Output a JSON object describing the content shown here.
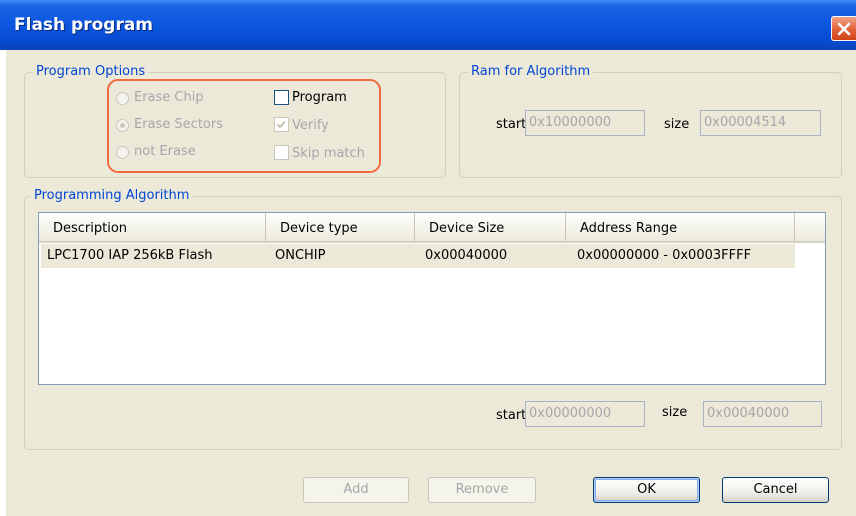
{
  "window": {
    "title": "Flash program"
  },
  "program_options": {
    "legend": "Program Options",
    "erase_chip": "Erase Chip",
    "erase_sectors": "Erase Sectors",
    "not_erase": "not Erase",
    "program": "Program",
    "verify": "Verify",
    "skip_match": "Skip match",
    "selected": "Erase Sectors",
    "program_checked": false,
    "verify_checked": true,
    "skip_match_checked": false
  },
  "ram": {
    "legend": "Ram for Algorithm",
    "start_label": "start",
    "start_value": "0x10000000",
    "size_label": "size",
    "size_value": "0x00004514"
  },
  "algorithm": {
    "legend": "Programming Algorithm",
    "columns": [
      "Description",
      "Device type",
      "Device Size",
      "Address Range"
    ],
    "rows": [
      {
        "description": "LPC1700 IAP 256kB Flash",
        "device_type": "ONCHIP",
        "device_size": "0x00040000",
        "address_range": "0x00000000 - 0x0003FFFF"
      }
    ],
    "start_label": "start",
    "start_value": "0x00000000",
    "size_label": "size",
    "size_value": "0x00040000"
  },
  "buttons": {
    "add": "Add",
    "remove": "Remove",
    "ok": "OK",
    "cancel": "Cancel"
  },
  "colors": {
    "titlebar": "#0a56e0",
    "legend": "#0046d5",
    "highlight": "#f06a3e",
    "dialog_bg": "#ece9d8"
  }
}
